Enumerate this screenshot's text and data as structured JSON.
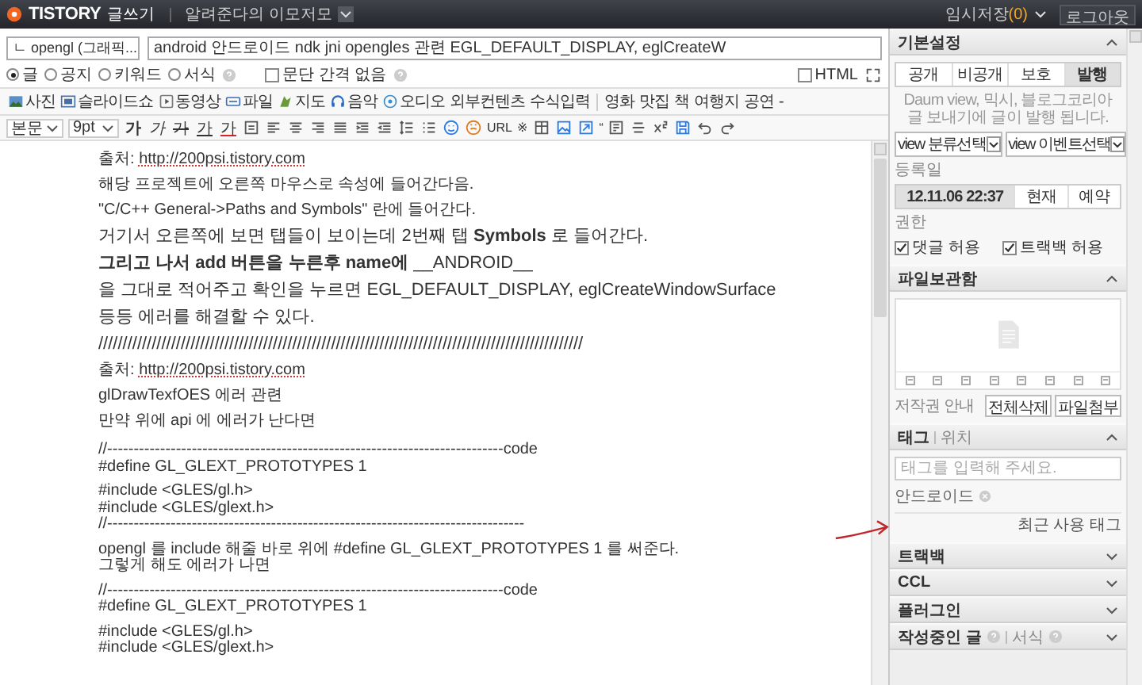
{
  "top_bar": {
    "logo": "TISTORY",
    "mode": "글쓰기",
    "blog_name": "알려준다의 이모저모",
    "temp_save": {
      "label": "임시저장",
      "count": "(0)"
    },
    "logout": "로그아웃"
  },
  "post": {
    "category": "ㄴ opengl (그래픽...",
    "title": "android 안드로이드 ndk jni opengles 관련 EGL_DEFAULT_DISPLAY, eglCreateW",
    "post_types": [
      {
        "label": "글",
        "selected": true
      },
      {
        "label": "공지",
        "selected": false
      },
      {
        "label": "키워드",
        "selected": false
      },
      {
        "label": "서식",
        "selected": false
      }
    ]
  },
  "paragraph_spacing": {
    "label": "문단 간격 없음",
    "checked": false
  },
  "html_mode": {
    "label": "HTML",
    "checked": false
  },
  "insert_toolbar": [
    "사진",
    "슬라이드쇼",
    "동영상",
    "파일",
    "지도",
    "음악",
    "오디오",
    "외부컨텐츠",
    "수식입력"
  ],
  "info_toolbar": [
    "영화",
    "맛집",
    "책",
    "여행지",
    "공연",
    "-"
  ],
  "format_toolbar": {
    "paragraph_style": "본문",
    "font_size": "9pt",
    "text_styles": [
      "가",
      "가",
      "가",
      "가",
      "가"
    ],
    "text_buttons": [
      "URL",
      "※",
      "“"
    ]
  },
  "content": [
    {
      "kind": "source",
      "label": "출처:",
      "link": "http://200psi.tistory.com"
    },
    {
      "kind": "text",
      "text": "해당 프로젝트에 오른쪽 마우스로 속성에 들어간다음."
    },
    {
      "kind": "text",
      "text": " \"C/C++ General->Paths and Symbols\"  란에 들어간다."
    },
    {
      "kind": "large",
      "text": "거기서 오른쪽에 보면 탭들이 보이는데 2번째 탭 **Symbols** 로 들어간다."
    },
    {
      "kind": "large",
      "text": "**그리고 나서 add 버튼을 누른후 name에** __ANDROID__"
    },
    {
      "kind": "large",
      "text": "을 그대로 적어주고 확인을 누르면 EGL_DEFAULT_DISPLAY, eglCreateWindowSurface"
    },
    {
      "kind": "large",
      "text": "등등 에러를 해결할 수 있다."
    },
    {
      "kind": "large",
      "text": "////////////////////////////////////////////////////////////////////////////////////////////////////"
    },
    {
      "kind": "source",
      "label": "출처:",
      "link": "http://200psi.tistory.com"
    },
    {
      "kind": "text",
      "text": "glDrawTexfOES 에러 관련"
    },
    {
      "kind": "text",
      "text": "만약 위에 api 에 에러가 난다면"
    },
    {
      "kind": "code",
      "lines": [
        "//---------------------------------------------------------------------------code",
        "#define GL_GLEXT_PROTOTYPES 1"
      ]
    },
    {
      "kind": "code",
      "lines": [
        "#include <GLES/gl.h>",
        "#include <GLES/glext.h>",
        "//-------------------------------------------------------------------------------"
      ]
    },
    {
      "kind": "code",
      "lines": [
        "opengl 를 include 해줄 바로 위에 #define GL_GLEXT_PROTOTYPES 1 를 써준다.",
        "그렇게 해도 에러가 나면"
      ]
    },
    {
      "kind": "code",
      "lines": [
        "//---------------------------------------------------------------------------code",
        "#define GL_GLEXT_PROTOTYPES 1"
      ]
    },
    {
      "kind": "code",
      "lines": [
        "#include <GLES/gl.h>",
        "#include <GLES/glext.h>"
      ]
    }
  ],
  "sidebar": {
    "basic": {
      "title": "기본설정",
      "expanded": true,
      "visibility": [
        {
          "label": "공개",
          "selected": false
        },
        {
          "label": "비공개",
          "selected": false
        },
        {
          "label": "보호",
          "selected": false
        },
        {
          "label": "발행",
          "selected": true
        }
      ],
      "note": "Daum view, 믹시, 블로그코리아 글 보내기에 글이 발행 됩니다.",
      "selects": [
        "view 분류선택",
        "view 이벤트선택"
      ],
      "date_label": "등록일",
      "date_options": [
        {
          "label": "12.11.06 22:37",
          "selected": true
        },
        {
          "label": "현재",
          "selected": false
        },
        {
          "label": "예약",
          "selected": false
        }
      ],
      "permission_label": "권한",
      "permissions": [
        {
          "label": "댓글 허용",
          "checked": true
        },
        {
          "label": "트랙백 허용",
          "checked": true
        }
      ]
    },
    "files": {
      "title": "파일보관함",
      "expanded": true,
      "copyright": "저작권 안내",
      "buttons": [
        "전체삭제",
        "파일첨부"
      ]
    },
    "tags": {
      "tabs": [
        {
          "label": "태그",
          "selected": true
        },
        {
          "label": "위치",
          "selected": false
        }
      ],
      "expanded": true,
      "placeholder": "태그를 입력해 주세요.",
      "items": [
        "안드로이드"
      ],
      "recent": "최근 사용 태그"
    },
    "collapsed": [
      {
        "title": "트랙백",
        "expanded": false
      },
      {
        "title": "CCL",
        "expanded": false
      },
      {
        "title": "플러그인",
        "expanded": false
      },
      {
        "title": "작성중인 글",
        "extra": "서식",
        "expanded": false
      }
    ]
  }
}
